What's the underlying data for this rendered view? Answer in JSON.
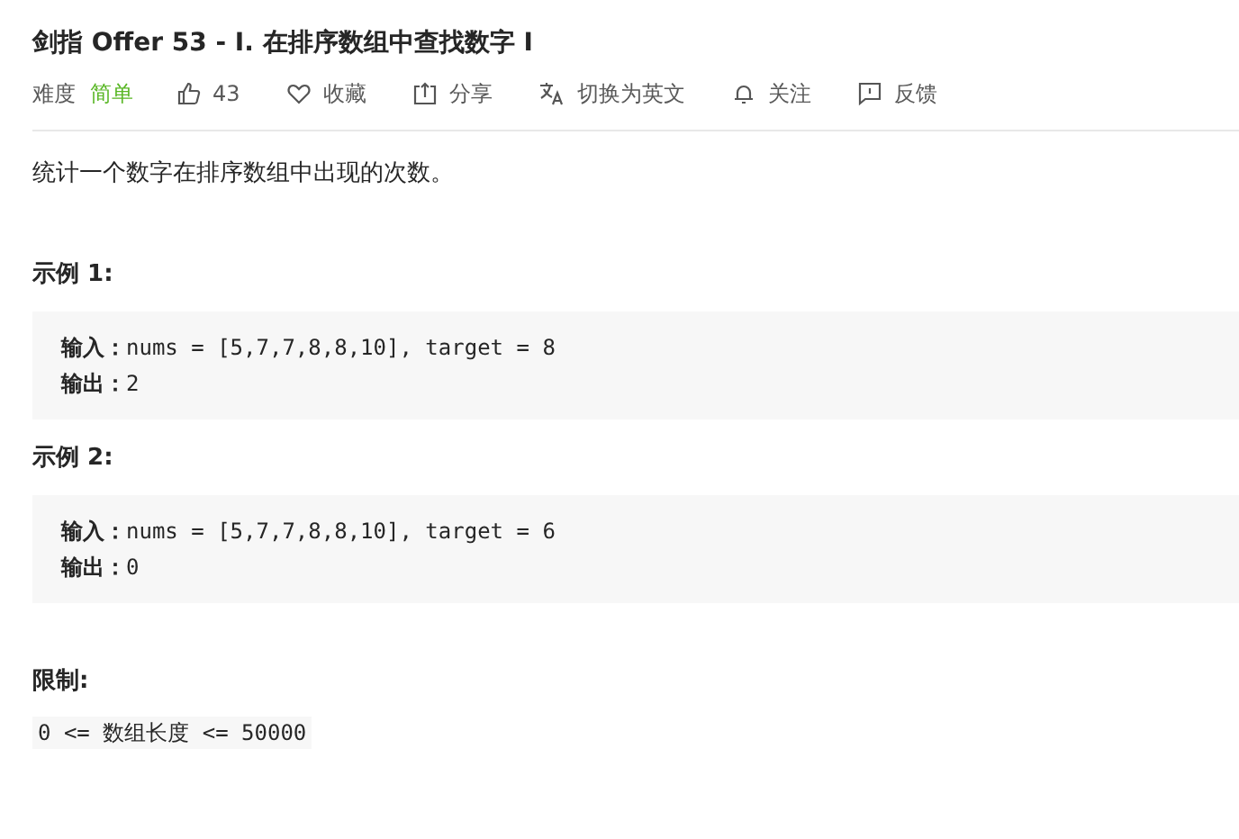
{
  "title": "剑指 Offer 53 - I. 在排序数组中查找数字 I",
  "difficulty": {
    "label": "难度",
    "value": "简单"
  },
  "actions": [
    {
      "kind": "like",
      "label": "43"
    },
    {
      "kind": "favorite",
      "label": "收藏"
    },
    {
      "kind": "share",
      "label": "分享"
    },
    {
      "kind": "translate",
      "label": "切换为英文"
    },
    {
      "kind": "follow",
      "label": "关注"
    },
    {
      "kind": "feedback",
      "label": "反馈"
    }
  ],
  "description": "统计一个数字在排序数组中出现的次数。",
  "examples": [
    {
      "heading": "示例 1:",
      "lines": [
        "**输入：**nums = [5,7,7,8,8,10], target = 8",
        "**输出：**2"
      ]
    },
    {
      "heading": "示例 2:",
      "lines": [
        "**输入：**nums = [5,7,7,8,8,10], target = 6",
        "**输出：**0"
      ]
    }
  ],
  "constraints": {
    "heading": "限制:",
    "code": "0 <= 数组长度 <= 50000"
  }
}
